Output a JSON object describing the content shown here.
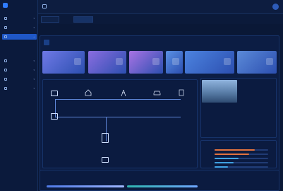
{
  "sidebar": {
    "title": "",
    "subtitle": "",
    "items": [
      {
        "label": ""
      },
      {
        "label": ""
      },
      {
        "label": ""
      },
      {
        "label": ""
      },
      {
        "label": ""
      },
      {
        "label": ""
      },
      {
        "label": ""
      },
      {
        "label": ""
      }
    ],
    "subitems": [
      {
        "label": ""
      },
      {
        "label": ""
      }
    ]
  },
  "header": {
    "breadcrumb": "",
    "user": ""
  },
  "tabs": [
    {
      "label": ""
    },
    {
      "label": ""
    }
  ],
  "page": {
    "title": ""
  },
  "station_tabs": [
    {
      "label": ""
    },
    {
      "label": ""
    },
    {
      "label": ""
    },
    {
      "label": ""
    },
    {
      "label": ""
    }
  ],
  "cards": [
    {
      "title": "",
      "line1": "",
      "line2": "",
      "color": "#6f79e6"
    },
    {
      "title": "",
      "line1": "",
      "line2": "",
      "color": "#8a6de0"
    },
    {
      "title": "",
      "line1": "",
      "line2": "",
      "color": "#a873e4"
    },
    {
      "title": "",
      "line1": "",
      "line2": "",
      "color": "#5a91e5"
    },
    {
      "title": "",
      "line1": "",
      "line2": "",
      "color": "#4c83df"
    },
    {
      "title": "",
      "line1": "",
      "line2": "",
      "color": "#5b8ad8"
    }
  ],
  "energy": {
    "title": "",
    "nodes": {
      "solar": "",
      "house": "",
      "grid": "",
      "car": "",
      "storage": "",
      "battery": ""
    },
    "values": {
      "left": "",
      "right": "",
      "bottom": ""
    }
  },
  "info": {
    "status1": "",
    "status2": "",
    "address": "",
    "stats": [
      {
        "label": "",
        "value": ""
      },
      {
        "label": "",
        "value": ""
      },
      {
        "label": "",
        "value": ""
      },
      {
        "label": "",
        "value": ""
      },
      {
        "label": "",
        "value": ""
      },
      {
        "label": "",
        "value": ""
      }
    ]
  },
  "ranking": {
    "title": "",
    "more": "",
    "rows": [
      {
        "label": "",
        "value": 0.75,
        "color": "#e2733f"
      },
      {
        "label": "",
        "value": 0.65,
        "color": "#e2733f"
      },
      {
        "label": "",
        "value": 0.45,
        "color": "#3fa1e2"
      },
      {
        "label": "",
        "value": 0.35,
        "color": "#3fa1e2"
      },
      {
        "label": "",
        "value": 0.25,
        "color": "#3fa1e2"
      }
    ]
  },
  "bottom": {
    "title": "",
    "date": "",
    "left": "",
    "right": ""
  }
}
